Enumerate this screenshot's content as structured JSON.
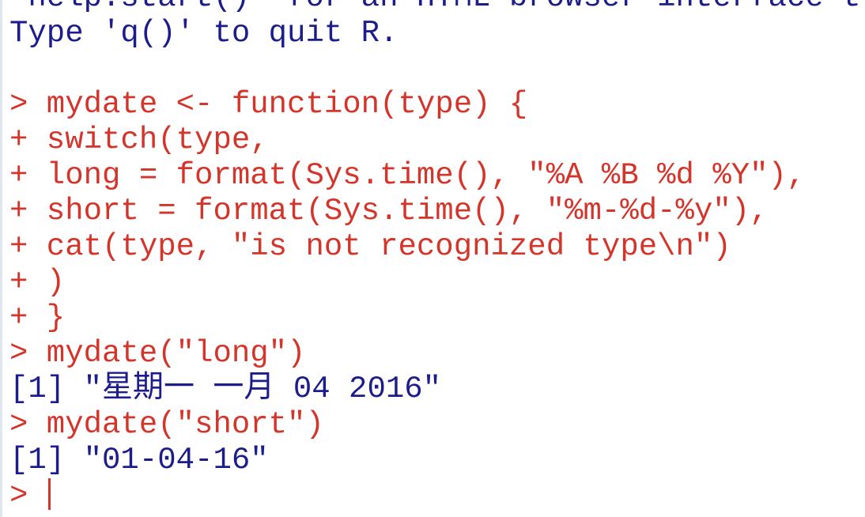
{
  "console": {
    "lines": [
      {
        "type": "output",
        "text": "'help.start()' for an HTML browser interface t"
      },
      {
        "type": "output",
        "text": "Type 'q()' to quit R."
      },
      {
        "type": "output",
        "text": ""
      },
      {
        "type": "input",
        "text": "> mydate <- function(type) {"
      },
      {
        "type": "input",
        "text": "+ switch(type,"
      },
      {
        "type": "input",
        "text": "+ long = format(Sys.time(), \"%A %B %d %Y\"),"
      },
      {
        "type": "input",
        "text": "+ short = format(Sys.time(), \"%m-%d-%y\"),"
      },
      {
        "type": "input",
        "text": "+ cat(type, \"is not recognized type\\n\")"
      },
      {
        "type": "input",
        "text": "+ )"
      },
      {
        "type": "input",
        "text": "+ }"
      },
      {
        "type": "input",
        "text": "> mydate(\"long\")"
      },
      {
        "type": "output",
        "text": "[1] \"星期一 一月 04 2016\""
      },
      {
        "type": "input",
        "text": "> mydate(\"short\")"
      },
      {
        "type": "output",
        "text": "[1] \"01-04-16\""
      }
    ],
    "prompt": "> ",
    "colors": {
      "input": "#d4352b",
      "output": "#1c1c8a"
    }
  }
}
